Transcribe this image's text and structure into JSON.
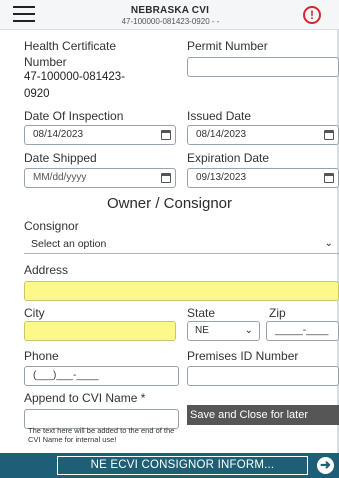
{
  "header": {
    "title": "NEBRASKA CVI",
    "subtitle": "47-100000-081423-0920 - -"
  },
  "icons": {
    "menu": "hamburger-menu-icon",
    "alert": "alert-circle-icon",
    "calendar": "calendar-icon",
    "chevron": "chevron-down-icon",
    "next": "arrow-right-circle-icon"
  },
  "colors": {
    "required_highlight": "#fcf98a",
    "footer": "#1f5f75",
    "alert": "#d8262a",
    "button": "#565656"
  },
  "form": {
    "health_certificate_label_line1": "Health Certificate",
    "health_certificate_label_line2": "Number",
    "health_certificate_value_line1": "47-100000-081423-",
    "health_certificate_value_line2": "0920",
    "permit_number_label": "Permit Number",
    "permit_number_value": "",
    "date_of_inspection_label": "Date Of Inspection",
    "date_of_inspection_value": "08/14/2023",
    "issued_date_label": "Issued Date",
    "issued_date_value": "08/14/2023",
    "date_shipped_label": "Date Shipped",
    "date_shipped_placeholder": "MM/dd/yyyy",
    "expiration_date_label": "Expiration Date",
    "expiration_date_value": "09/13/2023"
  },
  "owner_consignor": {
    "section_title": "Owner / Consignor",
    "consignor_label": "Consignor",
    "consignor_value": "Select an option",
    "address_label": "Address",
    "city_label": "City",
    "state_label": "State",
    "state_value": "NE",
    "zip_label": "Zip",
    "zip_placeholder": "_____-____",
    "phone_label": "Phone",
    "phone_placeholder": "(___)___-____",
    "premises_label": "Premises ID Number",
    "append_label": "Append to CVI Name *",
    "save_button": "Save and Close for later",
    "helper_text": "The text here will be added to the end of the CVI Name for internal use!"
  },
  "footer": {
    "button_label": "NE ECVI CONSIGNOR INFORM..."
  }
}
